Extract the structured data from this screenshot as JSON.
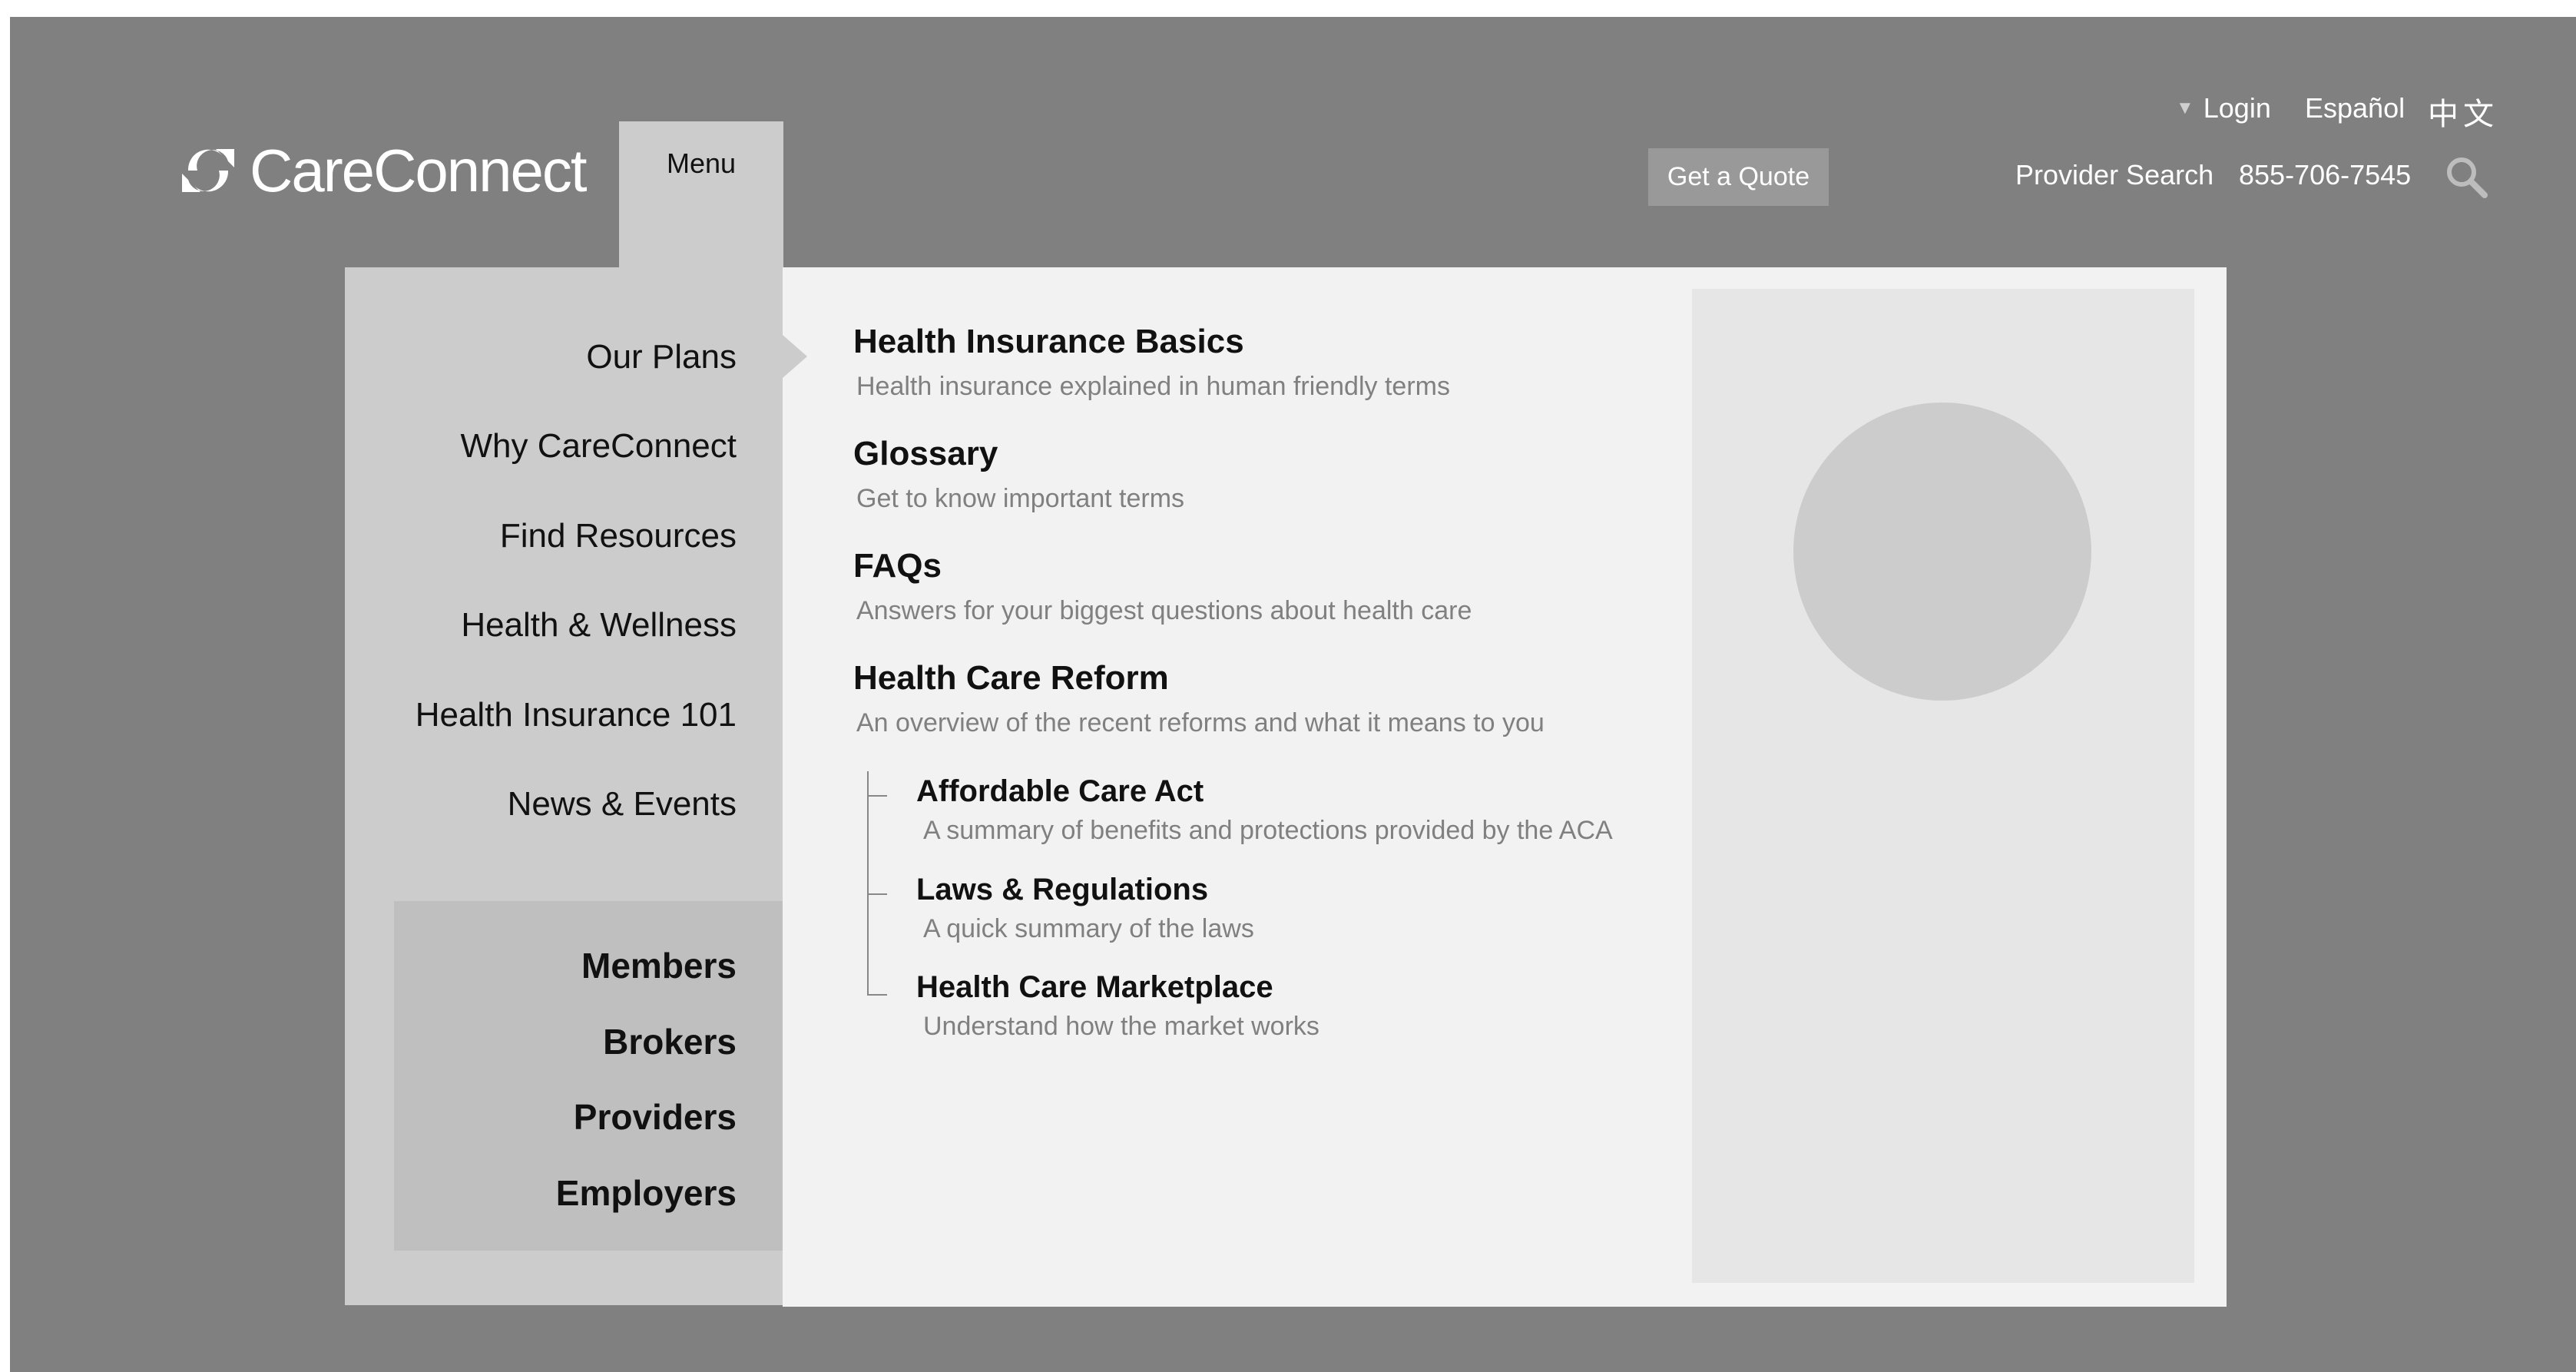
{
  "brand": {
    "name": "CareConnect",
    "logo_icon": "refresh-arrows-icon"
  },
  "header": {
    "menu_label": "Menu",
    "login_label": "Login",
    "espanol_label": "Español",
    "chinese_label": "中文",
    "quote_label": "Get a Quote",
    "provider_search_label": "Provider Search",
    "phone": "855-706-7545",
    "search_icon": "search-icon"
  },
  "nav": {
    "items": [
      {
        "label": "Our Plans"
      },
      {
        "label": "Why CareConnect"
      },
      {
        "label": "Find Resources"
      },
      {
        "label": "Health & Wellness"
      },
      {
        "label": "Health Insurance 101"
      },
      {
        "label": "News & Events"
      }
    ],
    "audiences": [
      {
        "label": "Members"
      },
      {
        "label": "Brokers"
      },
      {
        "label": "Providers"
      },
      {
        "label": "Employers"
      }
    ]
  },
  "content": {
    "items": [
      {
        "title": "Health Insurance Basics",
        "desc": "Health insurance explained in human friendly terms"
      },
      {
        "title": "Glossary",
        "desc": "Get to know important terms"
      },
      {
        "title": "FAQs",
        "desc": "Answers for your biggest questions about health care"
      },
      {
        "title": "Health Care Reform",
        "desc": "An overview of the recent reforms and what it means to you"
      }
    ],
    "subitems": [
      {
        "title": "Affordable Care Act",
        "desc": "A summary of benefits and protections provided by the ACA"
      },
      {
        "title": "Laws & Regulations",
        "desc": "A quick summary of the laws"
      },
      {
        "title": "Health Care Marketplace",
        "desc": "Understand how the market works"
      }
    ]
  },
  "colors": {
    "page_bg": "#808080",
    "nav_bg": "#cccccc",
    "audience_bg": "#bfbfbf",
    "content_bg": "#f2f2f2",
    "card_bg": "#e6e6e6"
  }
}
